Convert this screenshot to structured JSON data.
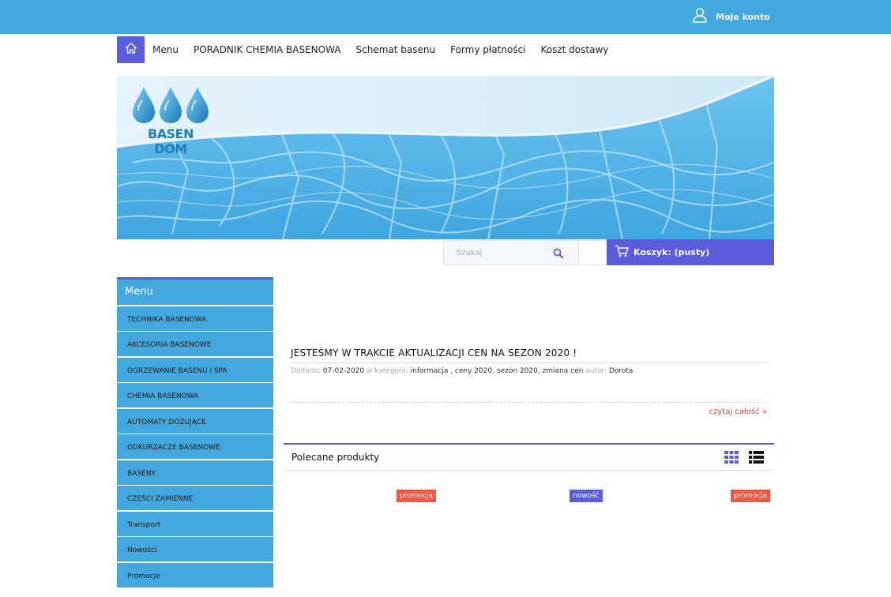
{
  "header": {
    "account_label": "Moje konto"
  },
  "nav": {
    "items": [
      {
        "label": "Menu"
      },
      {
        "label": "PORADNIK CHEMIA BASENOWA"
      },
      {
        "label": "Schemat basenu"
      },
      {
        "label": "Formy płatności"
      },
      {
        "label": "Koszt dostawy"
      }
    ]
  },
  "logo": {
    "text": "BASEN DOM"
  },
  "search": {
    "placeholder": "Szukaj"
  },
  "cart": {
    "label": "Koszyk: (pusty)"
  },
  "sidebar": {
    "title": "Menu",
    "items": [
      {
        "label": "TECHNIKA BASENOWA"
      },
      {
        "label": "AKCESORIA BASENOWE"
      },
      {
        "label": "OGRZEWANIE BASENU i SPA"
      },
      {
        "label": "CHEMIA BASENOWA"
      },
      {
        "label": "AUTOMATY DOZUJĄCE"
      },
      {
        "label": "ODKURZACZE BASENOWE"
      },
      {
        "label": "BASENY"
      },
      {
        "label": "CZĘŚCI ZAMIENNE"
      },
      {
        "label": "Transport"
      },
      {
        "label": "Nowości"
      },
      {
        "label": "Promocje"
      }
    ]
  },
  "post": {
    "title": "JESTEŚMY W TRAKCIE AKTUALIZACJI CEN NA SEZON 2020 !",
    "added_label": "Dodano:",
    "date": "07-02-2020",
    "category_label": "w kategorii:",
    "categories": "informacja , ceny 2020, sezon 2020, zmiana cen",
    "author_label": "autor:",
    "author": "Dorota",
    "read_more": "czytaj całość »"
  },
  "featured": {
    "title": "Polecane produkty",
    "badges": [
      {
        "label": "promocja",
        "kind": "promo"
      },
      {
        "label": "nowość",
        "kind": "new"
      },
      {
        "label": "promocja",
        "kind": "promo"
      }
    ]
  },
  "colors": {
    "top_bar": "#43a8de",
    "accent": "#5b5ddc",
    "promo": "#e85a48",
    "read_more": "#e2463a"
  }
}
